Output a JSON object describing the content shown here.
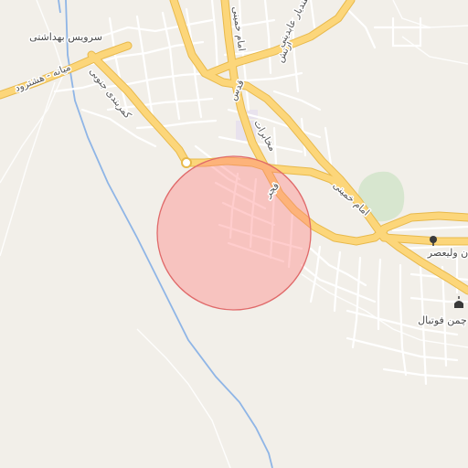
{
  "map": {
    "colors": {
      "land": "#f2efe9",
      "minor_road": "#ffffff",
      "major_road": "#fcd67a",
      "major_road_casing": "#e8b94b",
      "river": "#8fb5e6",
      "park": "#d7e6cf",
      "highlight_fill": "#ff7b7b",
      "highlight_stroke": "#e06a6a",
      "building": "#e6e0ef"
    },
    "labels": {
      "health_service": "سرویس بهداشتی",
      "mianeh_hashtroud": "میانه - هشترود",
      "kamarbandi_jonoubi": "کمربندی جنوبی",
      "imam_khomeini_1": "امام خمینی",
      "qods": "قدس",
      "artesh": "ارتش",
      "esfandiar_abadi": "اسفندیار عابدینی",
      "mokhaberat": "مخابرات",
      "fajr": "فجر",
      "imam_khomeini_2": "امام خمینی",
      "valiasr": "ن ولیعصر",
      "football": "چمن فوتبال"
    },
    "icons": {
      "valiasr_poi": "tree-icon",
      "football_poi": "mosque-icon"
    }
  }
}
